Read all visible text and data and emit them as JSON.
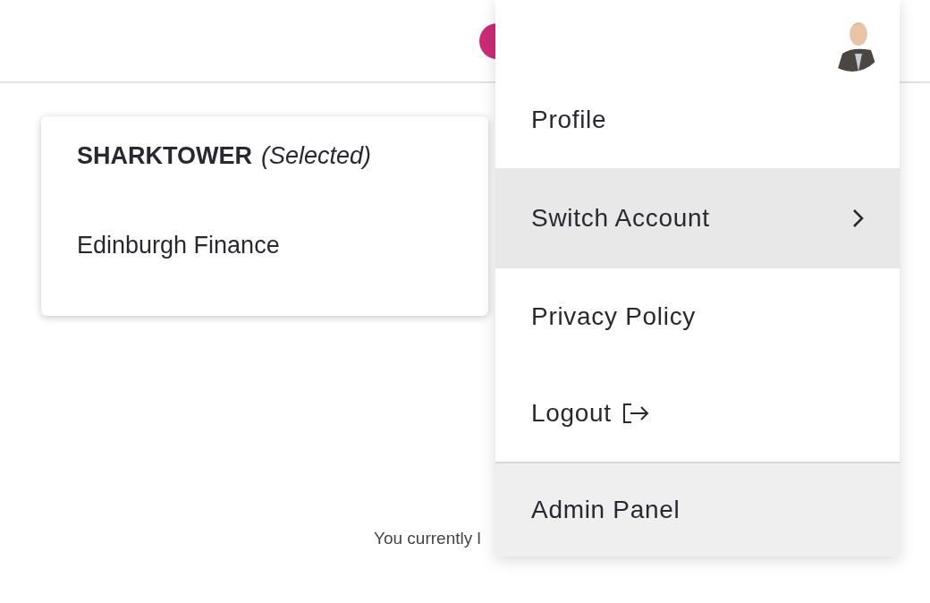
{
  "page": {
    "footer_text": "You currently l"
  },
  "account_switcher": {
    "accounts": [
      {
        "name": "SHARKTOWER",
        "note": "(Selected)",
        "selected": true
      },
      {
        "name": "Edinburgh Finance",
        "selected": false
      }
    ]
  },
  "user_menu": {
    "items": [
      {
        "label": "Profile",
        "kind": "link",
        "highlighted": false
      },
      {
        "label": "Switch Account",
        "kind": "submenu",
        "highlighted": true
      },
      {
        "label": "Privacy Policy",
        "kind": "link",
        "highlighted": false
      },
      {
        "label": "Logout",
        "kind": "logout",
        "highlighted": false
      },
      {
        "label": "Admin Panel",
        "kind": "admin",
        "highlighted": false
      }
    ]
  }
}
